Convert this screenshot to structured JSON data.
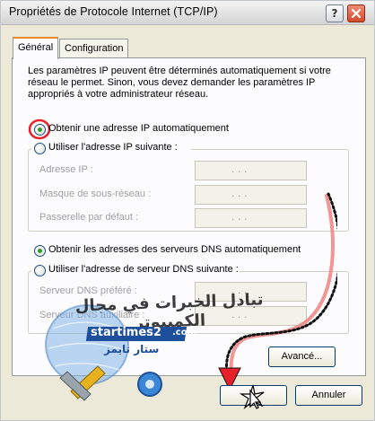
{
  "window": {
    "title": "Propriétés de Protocole Internet (TCP/IP)",
    "help_button": "?",
    "close_button": "✕"
  },
  "tabs": [
    {
      "label": "Général"
    },
    {
      "label": "Configuration alternative"
    }
  ],
  "description": "Les paramètres IP peuvent être déterminés automatiquement si votre\nréseau le permet. Sinon, vous devez demander les paramètres IP\nappropriés à votre administrateur réseau.",
  "ip_mode": {
    "auto_label": "Obtenir une adresse IP automatiquement",
    "manual_label": "Utiliser l'adresse IP suivante :",
    "selected": "auto",
    "fields": [
      {
        "label": "Adresse IP :",
        "value": ". . ."
      },
      {
        "label": "Masque de sous-réseau :",
        "value": ". . ."
      },
      {
        "label": "Passerelle par défaut :",
        "value": ". . ."
      }
    ]
  },
  "dns_mode": {
    "auto_label": "Obtenir les adresses des serveurs DNS automatiquement",
    "manual_label": "Utiliser l'adresse de serveur DNS suivante :",
    "selected": "auto",
    "fields": [
      {
        "label": "Serveur DNS préféré :",
        "value": ". . ."
      },
      {
        "label": "Serveur DNS auxiliaire :",
        "value": ". . ."
      }
    ]
  },
  "buttons": {
    "advanced": "Avancé...",
    "ok": "OK",
    "cancel": "Annuler"
  },
  "watermark": {
    "arabic_text": "تبادل الخبرات في مجال الكمبيوتر",
    "site_name": "startimes2",
    "site_sub": "ستار تايمز",
    "site_domain": ".com"
  },
  "colors": {
    "window_bg": "#ece9d8",
    "panel_bg": "#fcfcfe",
    "tab_accent": "#e68b2c",
    "radio_dot": "#2f9b2f",
    "annotation_red": "#e8202a",
    "annotation_path_pink": "#f08a8a",
    "annotation_path_black": "#111111",
    "logo_blue": "#1d4f9c"
  }
}
